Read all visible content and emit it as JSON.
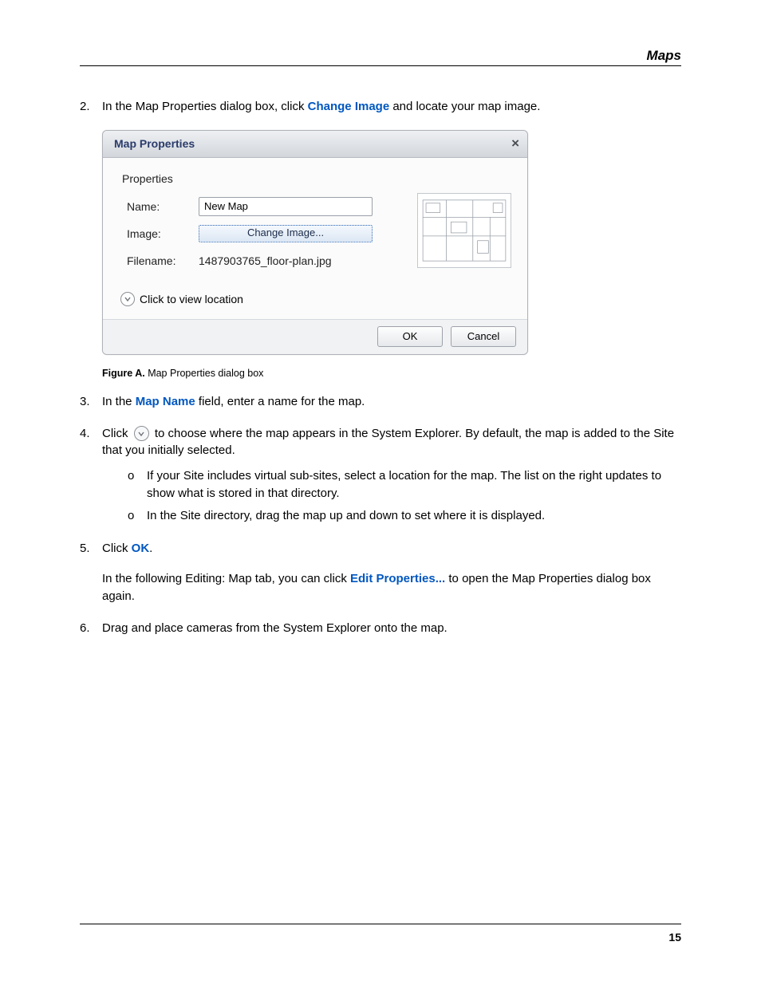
{
  "header": {
    "section": "Maps"
  },
  "steps": {
    "s2": {
      "num": "2.",
      "pre": "In the Map Properties dialog box, click ",
      "action": "Change Image",
      "post": " and locate your map image."
    },
    "s3": {
      "num": "3.",
      "pre": "In the ",
      "field": "Map Name",
      "post": " field, enter a name for the map."
    },
    "s4": {
      "num": "4.",
      "pre": "Click ",
      "post": " to choose where the map appears in the System Explorer. By default, the map is added to the Site that you initially selected.",
      "sub_a": "If your Site includes virtual sub-sites, select a location for the map. The list on the right updates to show what is stored in that directory.",
      "sub_b": "In the Site directory, drag the map up and down to set where it is displayed."
    },
    "s5": {
      "num": "5.",
      "pre": "Click ",
      "action": "OK",
      "post": ".",
      "follow_pre": "In the following Editing: Map tab, you can click ",
      "follow_action": "Edit Properties...",
      "follow_post": " to open the Map Properties dialog box again."
    },
    "s6": {
      "num": "6.",
      "text": "Drag and place cameras from the System Explorer onto the map."
    }
  },
  "dialog": {
    "title": "Map Properties",
    "close": "×",
    "section_heading": "Properties",
    "labels": {
      "name": "Name:",
      "image": "Image:",
      "filename": "Filename:"
    },
    "values": {
      "name": "New Map",
      "change_image": "Change Image...",
      "filename": "1487903765_floor-plan.jpg"
    },
    "expander": "Click to view location",
    "buttons": {
      "ok": "OK",
      "cancel": "Cancel"
    }
  },
  "figure": {
    "label": "Figure A.",
    "caption": " Map Properties dialog box"
  },
  "bullets": {
    "circ": "o"
  },
  "footer": {
    "page": "15"
  }
}
